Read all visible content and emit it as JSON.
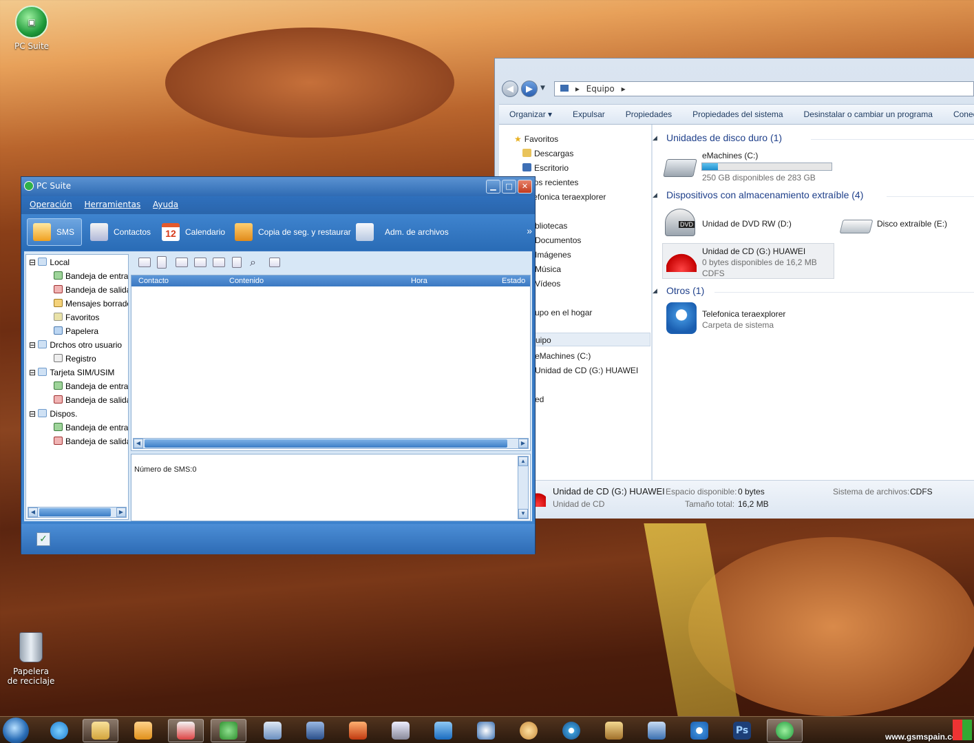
{
  "desktop": {
    "icons": [
      {
        "label": "PC Suite"
      },
      {
        "label": "Papelera de reciclaje"
      }
    ]
  },
  "explorer": {
    "address": [
      "Equipo"
    ],
    "commands": [
      "Organizar ▾",
      "Expulsar",
      "Propiedades",
      "Propiedades del sistema",
      "Desinstalar o cambiar un programa",
      "Conect"
    ],
    "nav": {
      "favorites_label": "Favoritos",
      "favorites": [
        "Descargas",
        "Escritorio",
        "Sitios recientes",
        "Telefonica teraexplorer"
      ],
      "libraries": [
        "bliotecas",
        "Documentos",
        "Imágenes",
        "Música",
        "Vídeos"
      ],
      "homegroup": "upo en el hogar",
      "computer": "uipo",
      "computer_items": [
        "eMachines (C:)",
        "Unidad de CD (G:) HUAWEI"
      ],
      "network": "ed"
    },
    "groups": {
      "hdd": "Unidades de disco duro (1)",
      "removable": "Dispositivos con almacenamiento extraíble (4)",
      "other": "Otros (1)"
    },
    "drives": {
      "c_name": "eMachines (C:)",
      "c_free": "250 GB disponibles de 283 GB",
      "c_used_fraction": 0.12,
      "dvd_name": "Unidad de DVD RW (D:)",
      "dvd_badge": "DVD",
      "e_name": "Disco extraíble (E:)",
      "g_name": "Unidad de CD (G:) HUAWEI",
      "g_free": "0 bytes disponibles de 16,2 MB",
      "g_fs": "CDFS",
      "tel_name": "Telefonica teraexplorer",
      "tel_sub": "Carpeta de sistema"
    },
    "status": {
      "title": "Unidad de CD (G:) HUAWEI",
      "type": "Unidad de CD",
      "space_label": "Espacio disponible:",
      "space_value": "0 bytes",
      "total_label": "Tamaño total:",
      "total_value": "16,2 MB",
      "fs_label": "Sistema de archivos:",
      "fs_value": "CDFS"
    }
  },
  "pcsuite": {
    "title": "PC Suite",
    "menu": [
      "Operación",
      "Herramientas",
      "Ayuda"
    ],
    "tabs": [
      "SMS",
      "Contactos",
      "Calendario",
      "Copia de seg. y restaurar",
      "Adm. de archivos"
    ],
    "calendar_day": "12",
    "more": "»",
    "tree": {
      "local": "Local",
      "local_items": [
        "Bandeja de entrad",
        "Bandeja de salida",
        "Mensajes borrador",
        "Favoritos",
        "Papelera"
      ],
      "other_user": "Drchos otro usuario",
      "other_items": [
        "Registro"
      ],
      "sim": "Tarjeta SIM/USIM",
      "sim_items": [
        "Bandeja de entrad",
        "Bandeja de salida"
      ],
      "device": "Dispos.",
      "device_items": [
        "Bandeja de entrad",
        "Bandeja de salida"
      ]
    },
    "columns": [
      "Contacto",
      "Contenido",
      "Hora",
      "Estado"
    ],
    "sms_count": "Número de SMS:0"
  },
  "watermark": "www.gsmspain.com"
}
